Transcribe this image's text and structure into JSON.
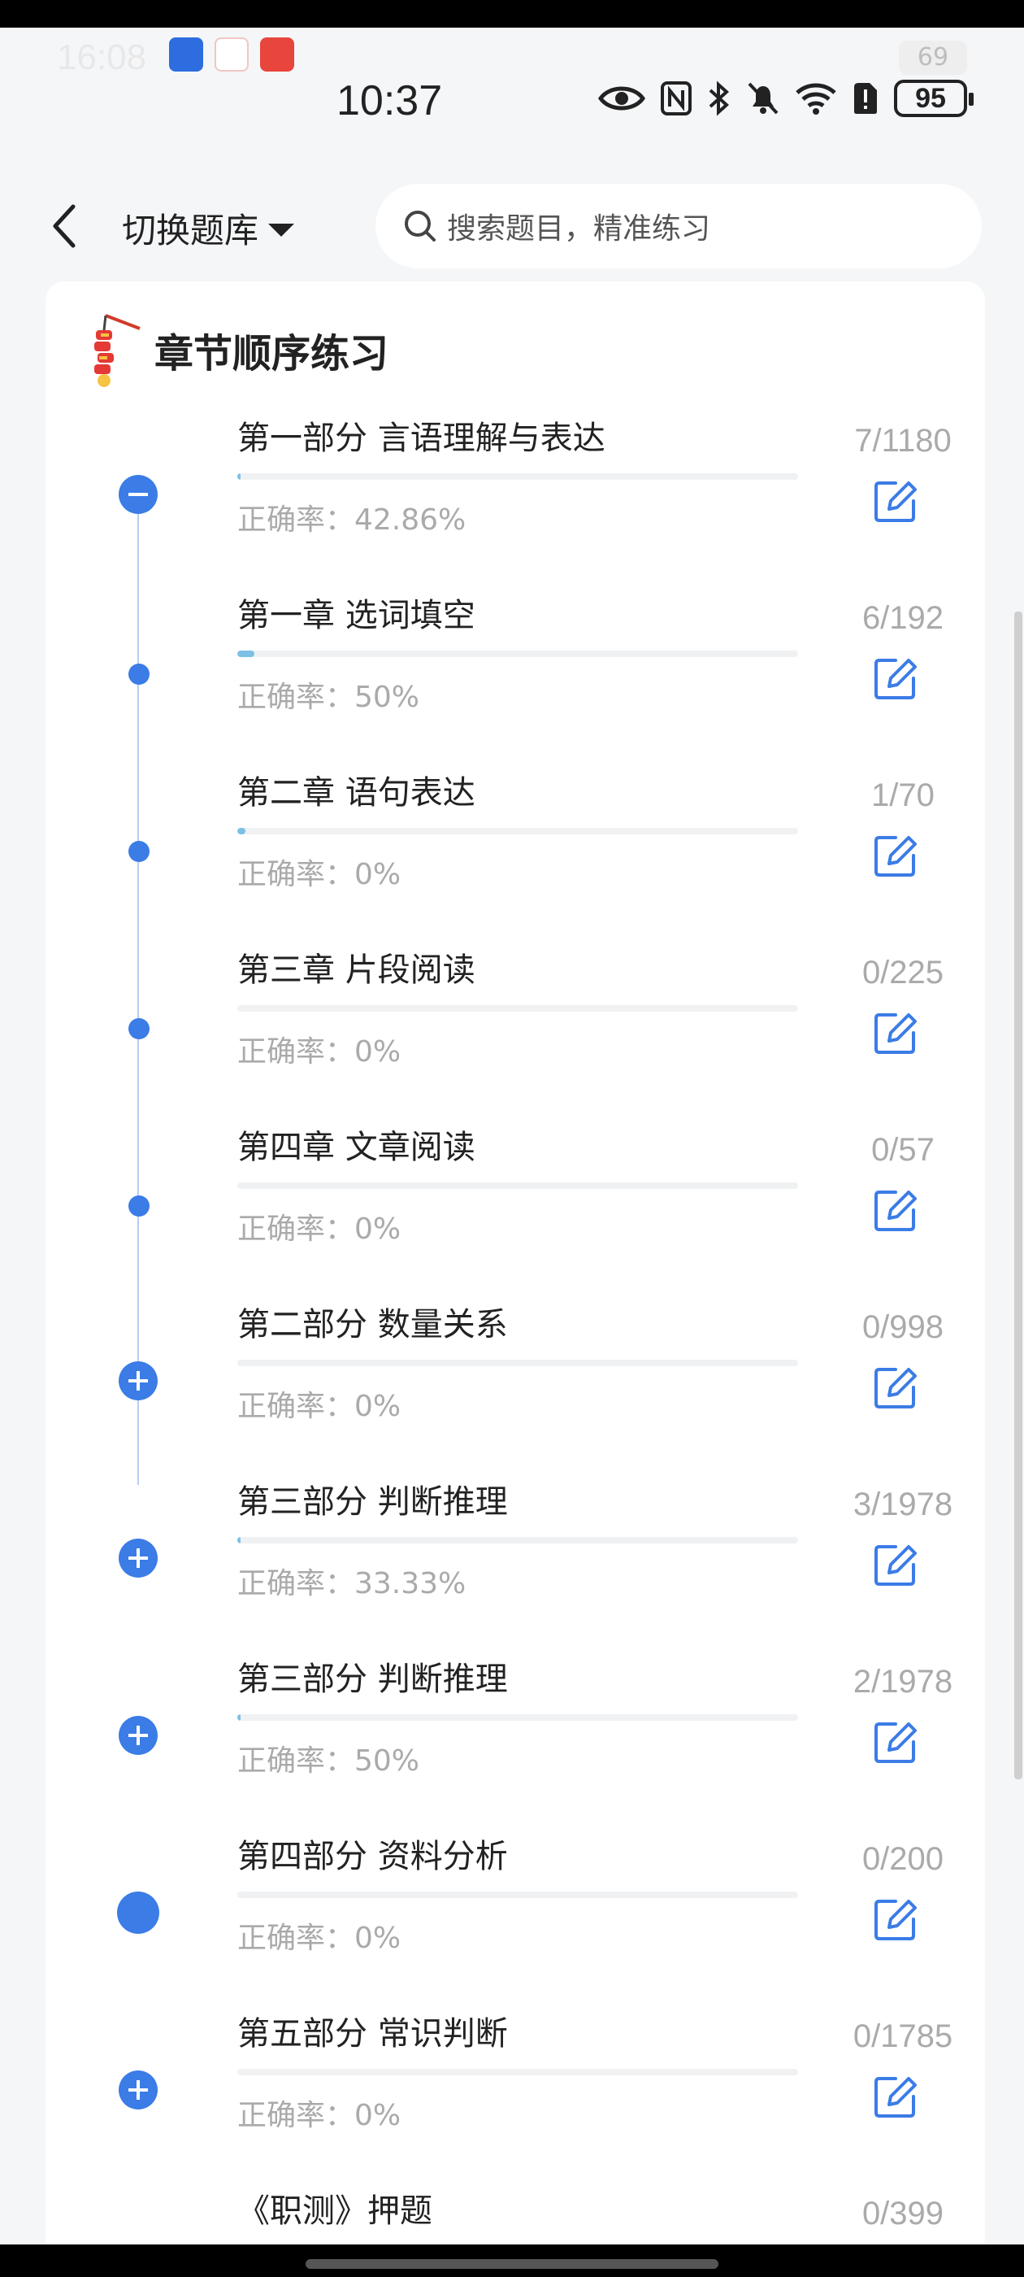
{
  "status_bar": {
    "ghost_time": "16:08",
    "ghost_battery": "69",
    "time": "10:37",
    "battery": "95"
  },
  "header": {
    "switch_label": "切换题库",
    "search_placeholder": "搜索题目，精准练习"
  },
  "section": {
    "title": "章节顺序练习"
  },
  "rows": [
    {
      "title": "第一部分 言语理解与表达",
      "accuracy": "正确率：42.86%",
      "count": "7/1180",
      "progress": 0.006,
      "node": "collapse"
    },
    {
      "title": "第一章 选词填空",
      "accuracy": "正确率：50%",
      "count": "6/192",
      "progress": 0.031,
      "node": "dot"
    },
    {
      "title": "第二章 语句表达",
      "accuracy": "正确率：0%",
      "count": "1/70",
      "progress": 0.014,
      "node": "dot"
    },
    {
      "title": "第三章 片段阅读",
      "accuracy": "正确率：0%",
      "count": "0/225",
      "progress": 0,
      "node": "dot"
    },
    {
      "title": "第四章 文章阅读",
      "accuracy": "正确率：0%",
      "count": "0/57",
      "progress": 0,
      "node": "dot"
    },
    {
      "title": "第二部分 数量关系",
      "accuracy": "正确率：0%",
      "count": "0/998",
      "progress": 0,
      "node": "expand"
    },
    {
      "title": "第三部分 判断推理",
      "accuracy": "正确率：33.33%",
      "count": "3/1978",
      "progress": 0.0015,
      "node": "expand"
    },
    {
      "title": "第三部分 判断推理",
      "accuracy": "正确率：50%",
      "count": "2/1978",
      "progress": 0.001,
      "node": "expand"
    },
    {
      "title": "第四部分 资料分析",
      "accuracy": "正确率：0%",
      "count": "0/200",
      "progress": 0,
      "node": "filled"
    },
    {
      "title": "第五部分 常识判断",
      "accuracy": "正确率：0%",
      "count": "0/1785",
      "progress": 0,
      "node": "expand"
    },
    {
      "title": "《职测》押题",
      "accuracy": "",
      "count": "0/399",
      "progress": 0,
      "node": "expand"
    }
  ],
  "colors": {
    "accent": "#3b7ce6",
    "progress": "#7cc0e6"
  }
}
